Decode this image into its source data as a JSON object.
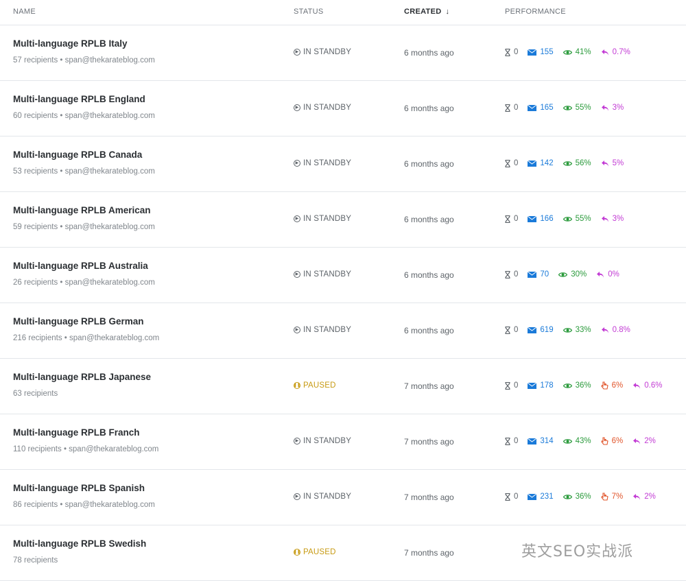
{
  "header": {
    "name": "NAME",
    "status": "STATUS",
    "created": "CREATED",
    "performance": "PERFORMANCE"
  },
  "rows": [
    {
      "title": "Multi-language RPLB Italy",
      "sub": "57 recipients • span@thekarateblog.com",
      "status": "IN STANDBY",
      "created": "6 months ago",
      "wait": "0",
      "sent": "155",
      "open": "41%",
      "click": "",
      "reply": "0.7%"
    },
    {
      "title": "Multi-language RPLB England",
      "sub": "60 recipients • span@thekarateblog.com",
      "status": "IN STANDBY",
      "created": "6 months ago",
      "wait": "0",
      "sent": "165",
      "open": "55%",
      "click": "",
      "reply": "3%"
    },
    {
      "title": "Multi-language RPLB Canada",
      "sub": "53 recipients • span@thekarateblog.com",
      "status": "IN STANDBY",
      "created": "6 months ago",
      "wait": "0",
      "sent": "142",
      "open": "56%",
      "click": "",
      "reply": "5%"
    },
    {
      "title": "Multi-language RPLB American",
      "sub": "59 recipients • span@thekarateblog.com",
      "status": "IN STANDBY",
      "created": "6 months ago",
      "wait": "0",
      "sent": "166",
      "open": "55%",
      "click": "",
      "reply": "3%"
    },
    {
      "title": "Multi-language RPLB Australia",
      "sub": "26 recipients • span@thekarateblog.com",
      "status": "IN STANDBY",
      "created": "6 months ago",
      "wait": "0",
      "sent": "70",
      "open": "30%",
      "click": "",
      "reply": "0%"
    },
    {
      "title": "Multi-language RPLB German",
      "sub": "216 recipients • span@thekarateblog.com",
      "status": "IN STANDBY",
      "created": "6 months ago",
      "wait": "0",
      "sent": "619",
      "open": "33%",
      "click": "",
      "reply": "0.8%"
    },
    {
      "title": "Multi-language RPLB Japanese",
      "sub": "63 recipients",
      "status": "PAUSED",
      "created": "7 months ago",
      "wait": "0",
      "sent": "178",
      "open": "36%",
      "click": "6%",
      "reply": "0.6%"
    },
    {
      "title": "Multi-language RPLB Franch",
      "sub": "110 recipients • span@thekarateblog.com",
      "status": "IN STANDBY",
      "created": "7 months ago",
      "wait": "0",
      "sent": "314",
      "open": "43%",
      "click": "6%",
      "reply": "2%"
    },
    {
      "title": "Multi-language RPLB Spanish",
      "sub": "86 recipients • span@thekarateblog.com",
      "status": "IN STANDBY",
      "created": "7 months ago",
      "wait": "0",
      "sent": "231",
      "open": "36%",
      "click": "7%",
      "reply": "2%"
    },
    {
      "title": "Multi-language RPLB Swedish",
      "sub": "78 recipients",
      "status": "PAUSED",
      "created": "7 months ago",
      "wait": "",
      "sent": "",
      "open": "",
      "click": "",
      "reply": ""
    }
  ],
  "icons": {
    "wait": "hourglass-icon",
    "sent": "envelope-icon",
    "open": "eye-icon",
    "click": "pointer-icon",
    "reply": "reply-icon",
    "standby": "play-circle-icon",
    "paused": "pause-circle-icon"
  },
  "colors": {
    "sent": "#1a7ad9",
    "open": "#2a9a3b",
    "click": "#e1542a",
    "reply": "#c23bd4",
    "paused": "#c79a12"
  },
  "watermark": "英文SEO实战派"
}
